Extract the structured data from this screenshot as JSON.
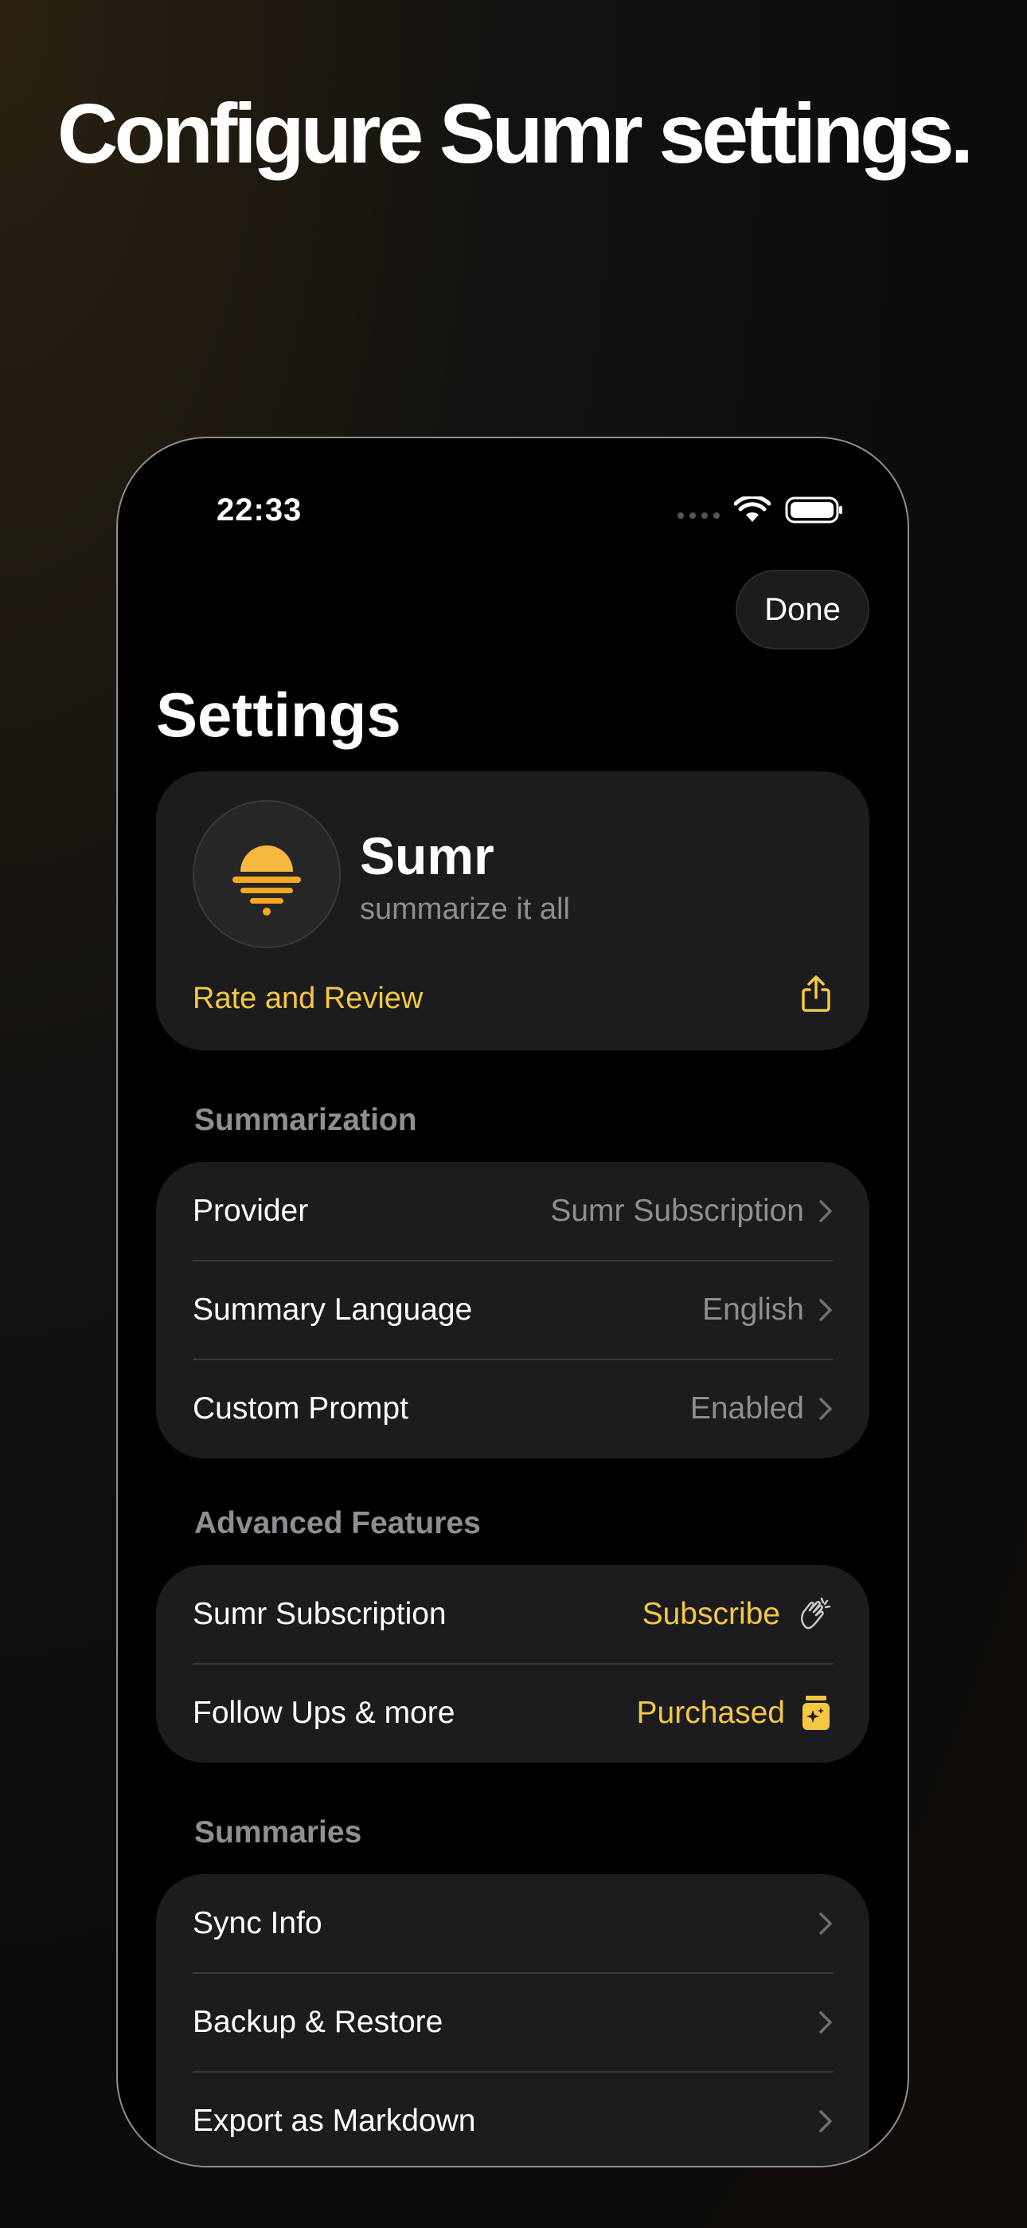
{
  "headline": "Configure Sumr settings.",
  "status": {
    "time": "22:33"
  },
  "nav": {
    "done_label": "Done"
  },
  "page_title": "Settings",
  "app": {
    "name": "Sumr",
    "tagline": "summarize it all",
    "rate_label": "Rate and Review",
    "icon": "sunset-logo"
  },
  "sections": {
    "summarization": {
      "header": "Summarization",
      "rows": [
        {
          "label": "Provider",
          "value": "Sumr Subscription",
          "icon": "chevron-right-icon"
        },
        {
          "label": "Summary Language",
          "value": "English",
          "icon": "chevron-right-icon"
        },
        {
          "label": "Custom Prompt",
          "value": "Enabled",
          "icon": "chevron-right-icon"
        }
      ]
    },
    "advanced": {
      "header": "Advanced Features",
      "rows": [
        {
          "label": "Sumr Subscription",
          "value": "Subscribe",
          "icon": "clapping-hands-icon"
        },
        {
          "label": "Follow Ups & more",
          "value": "Purchased",
          "icon": "sparkle-jar-icon"
        }
      ]
    },
    "summaries": {
      "header": "Summaries",
      "rows": [
        {
          "label": "Sync Info",
          "icon": "chevron-right-icon"
        },
        {
          "label": "Backup & Restore",
          "icon": "chevron-right-icon"
        },
        {
          "label": "Export as Markdown",
          "icon": "chevron-right-icon"
        }
      ]
    }
  },
  "colors": {
    "accent": "#f5c842",
    "card": "#1c1c1e",
    "secondary_text": "#8e8e93"
  }
}
